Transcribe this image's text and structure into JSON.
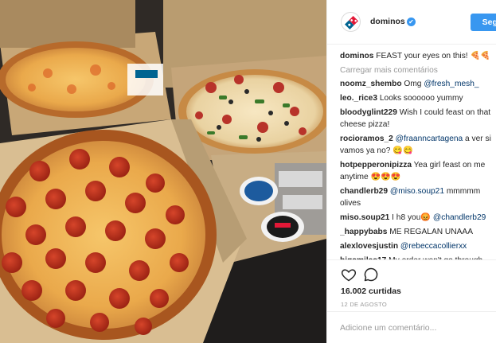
{
  "header": {
    "username": "dominos",
    "verified_glyph": "✔",
    "follow_label": "Segu",
    "logo_icon": "dominos-logo-icon"
  },
  "caption": {
    "username": "dominos",
    "text": "FEAST your eyes on this! 🍕🍕"
  },
  "load_more": "Carregar mais comentários",
  "comments": [
    {
      "user": "noomz_shembo",
      "parts": [
        {
          "t": "Omg "
        },
        {
          "m": "@fresh_mesh_"
        }
      ]
    },
    {
      "user": "leo._rice3",
      "parts": [
        {
          "t": "Looks soooooo yummy"
        }
      ]
    },
    {
      "user": "bloodyglint229",
      "parts": [
        {
          "t": "Wish I could feast on that cheese pizza!"
        }
      ]
    },
    {
      "user": "rocioramos_2",
      "parts": [
        {
          "m": "@fraanncartagena"
        },
        {
          "t": " a ver si vamos ya no? 😋😋"
        }
      ]
    },
    {
      "user": "hotpepperonipizza",
      "parts": [
        {
          "t": "Yea girl feast on me anytime 😍😍😍"
        }
      ]
    },
    {
      "user": "chandlerb29",
      "parts": [
        {
          "m": "@miso.soup21"
        },
        {
          "t": " mmmmm olives"
        }
      ]
    },
    {
      "user": "miso.soup21",
      "parts": [
        {
          "t": "I h8 you😡 "
        },
        {
          "m": "@chandlerb29"
        }
      ]
    },
    {
      "user": "_happybabs",
      "parts": [
        {
          "t": "ME REGALAN UNAAA"
        }
      ]
    },
    {
      "user": "alexlovesjustin",
      "parts": [
        {
          "m": "@rebeccacollierxx"
        }
      ]
    },
    {
      "user": "bigsmiles17",
      "parts": [
        {
          "t": "My order won't go through online "
        },
        {
          "m": "@dominos"
        },
        {
          "t": " and when I called the"
        }
      ]
    }
  ],
  "actions": {
    "like_icon": "heart-icon",
    "comment_icon": "comment-bubble-icon",
    "likes": "16.002 curtidas",
    "date": "12 DE AGOSTO"
  },
  "add_comment": {
    "placeholder": "Adicione um comentário..."
  },
  "colors": {
    "accent": "#3897f0",
    "mention": "#003569",
    "muted": "#999999",
    "dominos_blue": "#006491",
    "dominos_red": "#e31837"
  }
}
